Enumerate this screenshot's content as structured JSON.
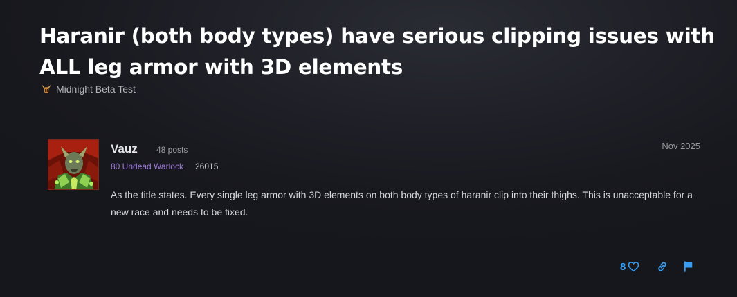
{
  "topic": {
    "title": "Haranir (both body types) have serious clipping issues with ALL leg armor with 3D elements",
    "category": "Midnight Beta Test",
    "category_icon": "horned-helmet-icon"
  },
  "post": {
    "author": "Vauz",
    "post_count": "48 posts",
    "character": "80 Undead Warlock",
    "achievement_points": "26015",
    "date": "Nov 2025",
    "body": "As the title states. Every single leg armor with 3D elements on both body types of haranir clip into their thighs. This is unacceptable for a new race and needs to be fixed.",
    "likes": "8"
  },
  "colors": {
    "accent": "#3a9cf0",
    "class_warlock": "#9c7ad8",
    "background": "#1a1b21"
  }
}
